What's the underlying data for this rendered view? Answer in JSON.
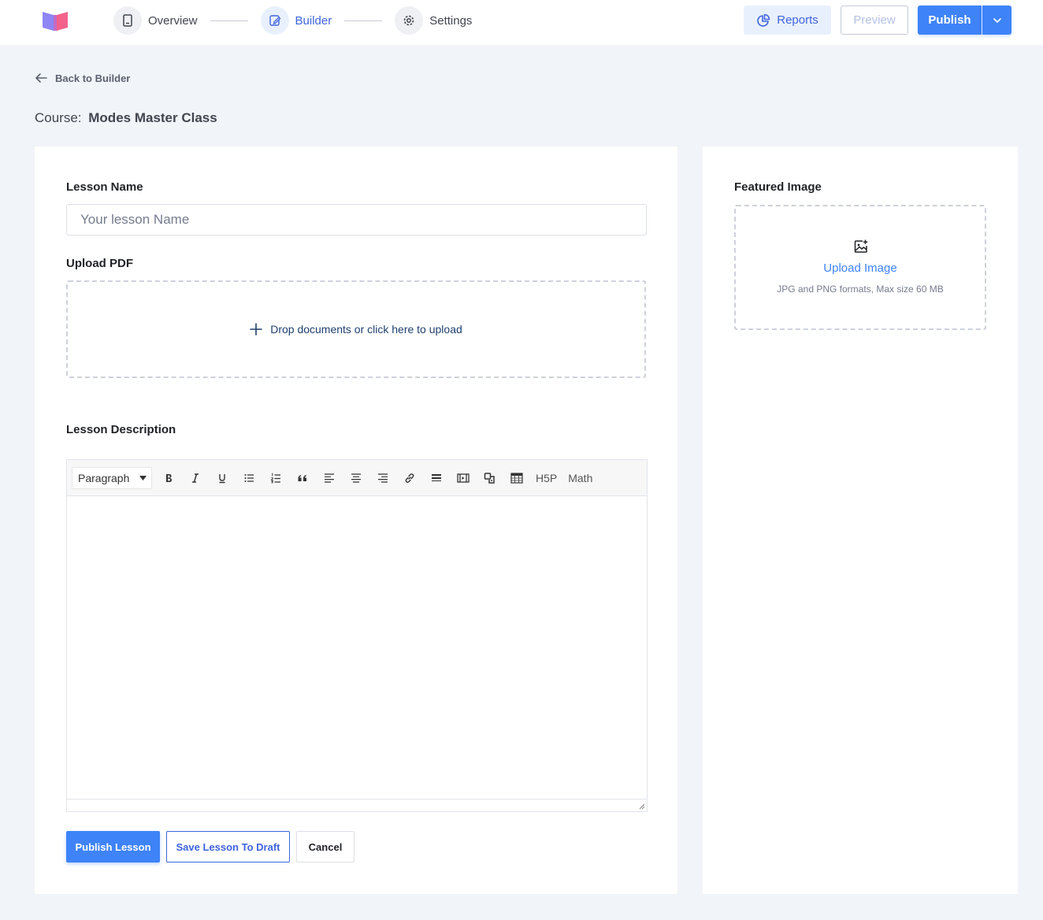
{
  "topbar": {
    "steps": [
      {
        "label": "Overview",
        "icon": "document-icon",
        "active": false
      },
      {
        "label": "Builder",
        "icon": "edit-icon",
        "active": true
      },
      {
        "label": "Settings",
        "icon": "gear-icon",
        "active": false
      }
    ],
    "reports_label": "Reports",
    "preview_label": "Preview",
    "publish_label": "Publish"
  },
  "header": {
    "back_label": "Back to Builder",
    "course_prefix": "Course:",
    "course_name": "Modes Master Class"
  },
  "lesson_form": {
    "name_label": "Lesson Name",
    "name_placeholder": "Your lesson Name",
    "name_value": "",
    "pdf_label": "Upload PDF",
    "pdf_drop_text": "Drop documents or click here to upload",
    "description_label": "Lesson Description",
    "editor": {
      "format_value": "Paragraph",
      "tools": [
        "bold-icon",
        "italic-icon",
        "underline-icon",
        "bullet-list-icon",
        "numbered-list-icon",
        "blockquote-icon",
        "align-left-icon",
        "align-center-icon",
        "align-right-icon",
        "link-icon",
        "horizontal-rule-icon",
        "media-icon",
        "code-sample-icon",
        "table-icon"
      ],
      "h5p_label": "H5P",
      "math_label": "Math"
    },
    "publish_lesson_label": "Publish Lesson",
    "save_draft_label": "Save Lesson To Draft",
    "cancel_label": "Cancel"
  },
  "featured_image": {
    "label": "Featured Image",
    "upload_title": "Upload Image",
    "upload_hint": "JPG and PNG formats, Max size 60 MB"
  },
  "colors": {
    "accent": "#3e83f8",
    "brand_blue": "#3e64de",
    "page_bg": "#f1f4f8"
  }
}
